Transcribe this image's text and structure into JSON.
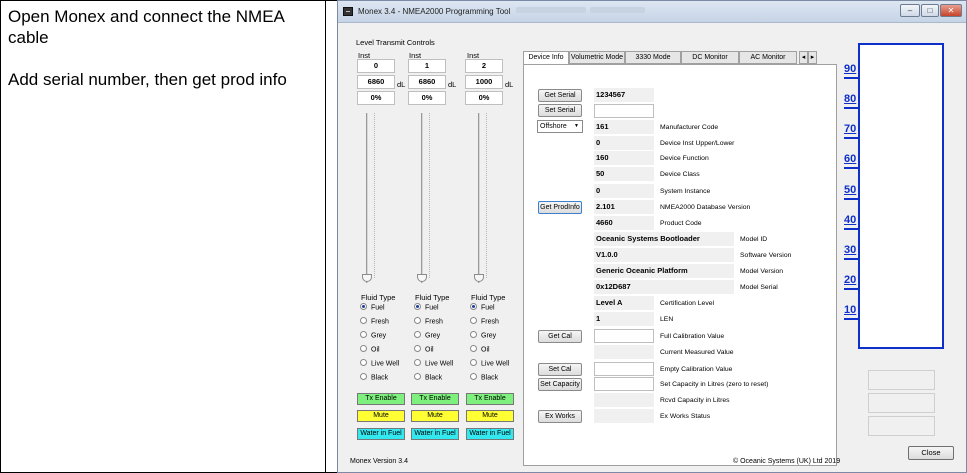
{
  "instructions": {
    "line1": "Open Monex and connect the NMEA cable",
    "line2": "Add serial number, then get prod info"
  },
  "window": {
    "title": "Monex 3.4 - NMEA2000 Programming Tool",
    "minimize": "–",
    "maximize": "□",
    "close": "✕"
  },
  "level_transmit": {
    "group_title": "Level Transmit Controls",
    "columns": [
      {
        "inst_label": "Inst",
        "inst": "0",
        "level": "6860",
        "unit": "dL",
        "percent": "0%",
        "fill": 0
      },
      {
        "inst_label": "Inst",
        "inst": "1",
        "level": "6860",
        "unit": "dL",
        "percent": "0%",
        "fill": 0
      },
      {
        "inst_label": "Inst",
        "inst": "2",
        "level": "1000",
        "unit": "dL",
        "percent": "0%",
        "fill": 0
      }
    ],
    "fluid_type_label": "Fluid Type",
    "fluid_options": [
      "Fuel",
      "Fresh",
      "Grey",
      "Oil",
      "Live Well",
      "Black"
    ],
    "selected_fluid": "Fuel",
    "buttons": {
      "tx_enable": "Tx Enable",
      "mute": "Mute",
      "water_in_fuel": "Water in Fuel"
    }
  },
  "tabs": [
    "Device Info",
    "Volumetric Mode",
    "3330 Mode",
    "DC Monitor",
    "AC Monitor"
  ],
  "tab_scroll": {
    "left": "◂",
    "right": "▸"
  },
  "device_info": {
    "get_serial": "Get Serial",
    "serial_value": "1234567",
    "set_serial": "Set Serial",
    "manufacturer_select": "Offshore",
    "get_prodinfo": "Get ProdInfo",
    "get_cal": "Get Cal",
    "set_cal": "Set Cal",
    "set_capacity": "Set Capacity",
    "ex_works": "Ex Works",
    "fields": [
      {
        "value": "161",
        "label": "Manufacturer Code"
      },
      {
        "value": "0",
        "label": "Device Inst Upper/Lower"
      },
      {
        "value": "160",
        "label": "Device Function"
      },
      {
        "value": "50",
        "label": "Device Class"
      },
      {
        "value": "0",
        "label": "System Instance"
      },
      {
        "value": "2.101",
        "label": "NMEA2000 Database Version"
      },
      {
        "value": "4660",
        "label": "Product Code"
      },
      {
        "value": "Oceanic Systems Bootloader",
        "label": "Model ID"
      },
      {
        "value": "V1.0.0",
        "label": "Software Version"
      },
      {
        "value": "Generic Oceanic Platform",
        "label": "Model Version"
      },
      {
        "value": "0x12D687",
        "label": "Model Serial"
      },
      {
        "value": "Level A",
        "label": "Certification Level"
      },
      {
        "value": "1",
        "label": "LEN"
      }
    ],
    "cal_fields": [
      {
        "value": "",
        "label": "Full Calibration Value"
      },
      {
        "value": "",
        "label": "Current Measured Value"
      },
      {
        "value": "",
        "label": "Empty Calibration Value"
      },
      {
        "value": "",
        "label": "Set Capacity in Litres (zero to reset)"
      },
      {
        "value": "",
        "label": "Rcvd Capacity in Litres"
      },
      {
        "value": "",
        "label": "Ex Works Status"
      }
    ]
  },
  "gauge": {
    "ticks": [
      "90",
      "80",
      "70",
      "60",
      "50",
      "40",
      "30",
      "20",
      "10"
    ],
    "level_percent": 0
  },
  "footer": {
    "version": "Monex Version 3.4",
    "copyright": "© Oceanic Systems (UK) Ltd 2019",
    "close": "Close"
  },
  "colors": {
    "accent_blue": "#0f2fc9",
    "tx_green": "#7df07d",
    "mute_yellow": "#ffff33",
    "water_cyan": "#33e8ee"
  }
}
